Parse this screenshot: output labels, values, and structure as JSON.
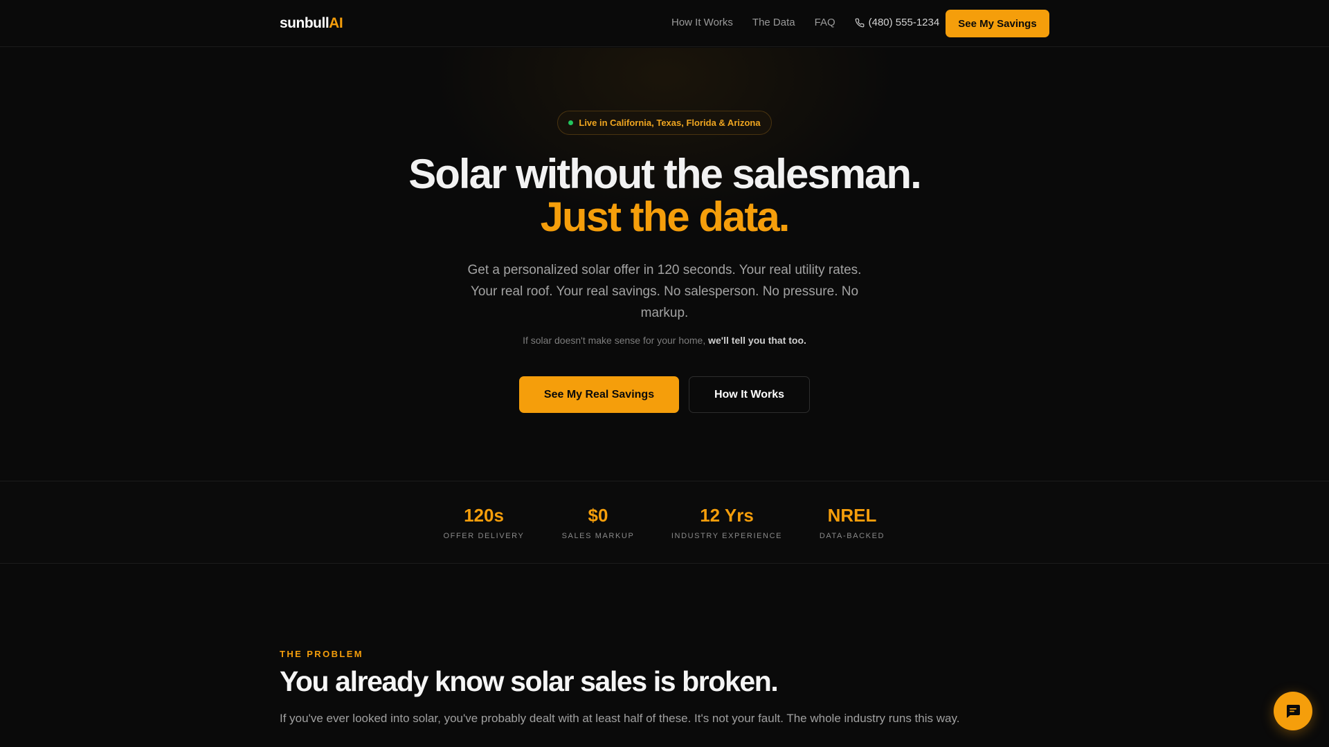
{
  "nav": {
    "logo_main": "sunbull",
    "logo_accent": "AI",
    "links": [
      "How It Works",
      "The Data",
      "FAQ"
    ],
    "phone": "(480) 555-1234",
    "cta": "See My Savings"
  },
  "hero": {
    "badge": "Live in California, Texas, Florida & Arizona",
    "title_line1": "Solar without the salesman.",
    "title_line2": "Just the data.",
    "subtitle": "Get a personalized solar offer in 120 seconds. Your real utility rates. Your real roof. Your real savings. No salesperson. No pressure. No markup.",
    "note_prefix": "If solar doesn't make sense for your home,",
    "note_bold": "we'll tell you that too.",
    "primary_button": "See My Real Savings",
    "secondary_button": "How It Works"
  },
  "stats": [
    {
      "value": "120s",
      "label": "OFFER DELIVERY"
    },
    {
      "value": "$0",
      "label": "SALES MARKUP"
    },
    {
      "value": "12 Yrs",
      "label": "INDUSTRY EXPERIENCE"
    },
    {
      "value": "NREL",
      "label": "DATA-BACKED"
    }
  ],
  "problem": {
    "eyebrow": "THE PROBLEM",
    "title": "You already know solar sales is broken.",
    "text": "If you've ever looked into solar, you've probably dealt with at least half of these. It's not your fault. The whole industry runs this way."
  },
  "icons": {
    "phone": "phone-icon",
    "chat": "chat-bubble-icon",
    "status_dot": "live-status-dot"
  },
  "colors": {
    "accent": "#f59e0b",
    "background": "#0a0a0a",
    "live_dot": "#22c55e"
  }
}
